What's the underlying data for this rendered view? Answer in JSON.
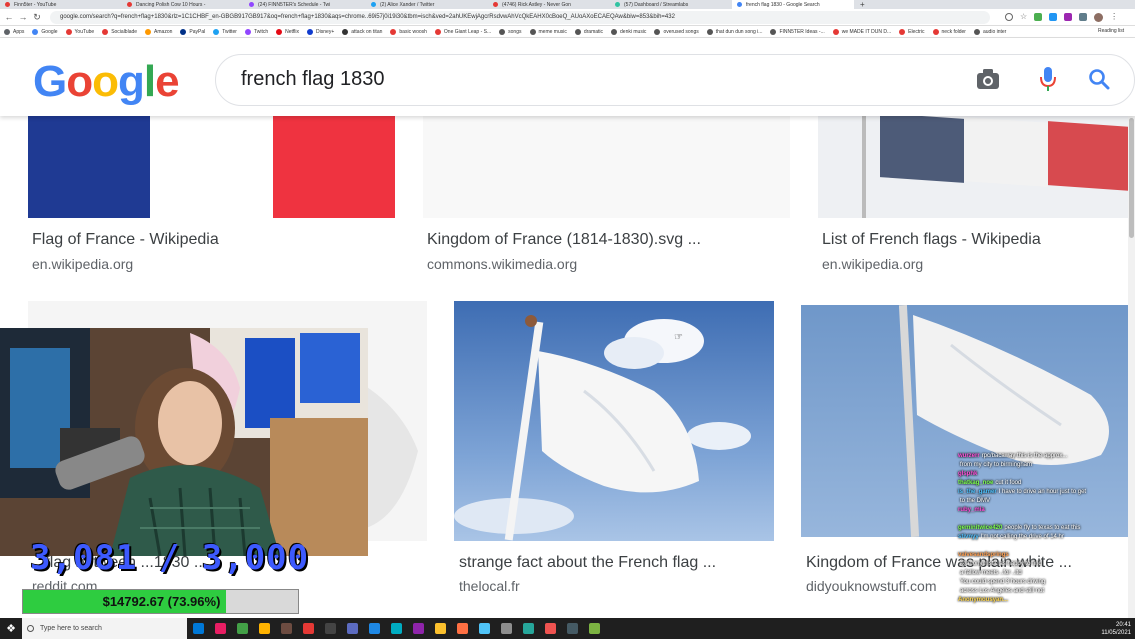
{
  "browser": {
    "tabs": [
      {
        "title": "Finn5ter - YouTube",
        "color": "#e53935"
      },
      {
        "title": "Dancing Polish Cow 10 Hours -",
        "color": "#e53935"
      },
      {
        "title": "(24) FINN5TER's Schedule - Twi",
        "color": "#9146ff"
      },
      {
        "title": "(2) Alice Xander / Twitter",
        "color": "#1da1f2"
      },
      {
        "title": "(4746) Rick Astley - Never Gon",
        "color": "#e53935"
      },
      {
        "title": "(57) Dashboard / Streamlabs",
        "color": "#31c3a2"
      },
      {
        "title": "french flag 1830 - Google Search",
        "color": "#4285f4"
      }
    ],
    "url": "google.com/search?q=french+flag+1830&rlz=1C1CHBF_en-GBGB917GB917&oq=french+flag+1830&aqs=chrome..69i57j0i19i30&tbm=isch&ved=2ahUKEwjAgcrRsdvwAhVcQkEAHX0cBoeQ_AUoAXoECAEQAw&biw=853&bih=432",
    "bookmarks": [
      {
        "label": "Apps",
        "color": "#5f6368"
      },
      {
        "label": "Google",
        "color": "#4285f4"
      },
      {
        "label": "YouTube",
        "color": "#e53935"
      },
      {
        "label": "Socialblade",
        "color": "#e53935"
      },
      {
        "label": "Amazon",
        "color": "#ff9900"
      },
      {
        "label": "PayPal",
        "color": "#003087"
      },
      {
        "label": "Twitter",
        "color": "#1da1f2"
      },
      {
        "label": "Twitch",
        "color": "#9146ff"
      },
      {
        "label": "Netflix",
        "color": "#e50914"
      },
      {
        "label": "Disney+",
        "color": "#113ccf"
      },
      {
        "label": "attack on titan",
        "color": "#333333"
      },
      {
        "label": "basic woosh",
        "color": "#e53935"
      },
      {
        "label": "One Giant Leap - S...",
        "color": "#e53935"
      },
      {
        "label": "songs",
        "color": "#555555"
      },
      {
        "label": "meme music",
        "color": "#555555"
      },
      {
        "label": "dramatic",
        "color": "#555555"
      },
      {
        "label": "denki music",
        "color": "#555555"
      },
      {
        "label": "overused songs",
        "color": "#555555"
      },
      {
        "label": "that dun dun song i...",
        "color": "#555555"
      },
      {
        "label": "FINN5TER Ideas -...",
        "color": "#555555"
      },
      {
        "label": "we MADE IT DUN D...",
        "color": "#e53935"
      },
      {
        "label": "Electric",
        "color": "#e53935"
      },
      {
        "label": "neck folder",
        "color": "#e53935"
      },
      {
        "label": "audio inter",
        "color": "#555555"
      }
    ],
    "reading_list": "Reading list"
  },
  "google": {
    "logo": {
      "letters": [
        "G",
        "o",
        "o",
        "g",
        "l",
        "e"
      ],
      "colors": [
        "#4285f4",
        "#ea4335",
        "#fbbc05",
        "#4285f4",
        "#34a853",
        "#ea4335"
      ]
    },
    "query": "french flag 1830"
  },
  "results": [
    {
      "title": "Flag of France - Wikipedia",
      "source": "en.wikipedia.org"
    },
    {
      "title": "Kingdom of France (1814-1830).svg ...",
      "source": "commons.wikimedia.org"
    },
    {
      "title": "List of French flags - Wikipedia",
      "source": "en.wikipedia.org"
    },
    {
      "title": "...flag between ...1830 ...",
      "source": "reddit.com"
    },
    {
      "title": "strange fact about the French flag ...",
      "source": "thelocal.fr"
    },
    {
      "title": "Kingdom of France was plain white ...",
      "source": "didyouknowstuff.com"
    }
  ],
  "stream": {
    "sub_counter": "3,081 / 3,000",
    "donation_text": "$14792.67 (73.96%)",
    "donation_progress": 0.7396,
    "chat": [
      {
        "user": "wurzerr",
        "text": "rpc/bacaway this is the approx...",
        "color": "#ff4fd8"
      },
      {
        "user": "",
        "text": "from my city to birmingham",
        "color": "#ffffff"
      },
      {
        "user": "glsphk",
        "text": "",
        "color": "#ff4fd8"
      },
      {
        "user": "thatkag_noe",
        "text": "cut it food",
        "color": "#7dff4f"
      },
      {
        "user": "is_the_gamer",
        "text": "I have to drive an hour just to get",
        "color": "#4fc3ff"
      },
      {
        "user": "",
        "text": "to the DMV",
        "color": "#ffffff"
      },
      {
        "user": "ruby_mia",
        "text": "",
        "color": "#ff4fd8"
      },
      {
        "user": "",
        "text": "",
        "color": "#ffffff"
      },
      {
        "user": "geminitwice420",
        "text": "people fly to texas to eat this",
        "color": "#7dff4f"
      },
      {
        "user": "stivnyy",
        "text": "I'm not calling the drive of 14 hr",
        "color": "#4fc3ff"
      },
      {
        "user": "",
        "text": "",
        "color": "#ffffff"
      },
      {
        "user": "vaivesandsprings",
        "text": "",
        "color": "#ff9f4f"
      },
      {
        "user": "",
        "text": "@anonymistic as happy to find",
        "color": "#ffffff"
      },
      {
        "user": "",
        "text": "a fallow meets ..for ..ltd",
        "color": "#ffffff"
      },
      {
        "user": "",
        "text": "You could spend 3 hours driving",
        "color": "#ffffff"
      },
      {
        "user": "",
        "text": "across Los Angeles and still not",
        "color": "#ffffff"
      },
      {
        "user": "Anonymousyan...",
        "text": "",
        "color": "#ffd84f"
      }
    ]
  },
  "taskbar": {
    "search_placeholder": "Type here to search",
    "time": "20:41",
    "date": "11/05/2021",
    "apps": [
      "#0078d7",
      "#e91e63",
      "#43a047",
      "#ffb300",
      "#6d4c41",
      "#e53935",
      "#444444",
      "#5c6bc0",
      "#1e88e5",
      "#00acc1",
      "#8e24aa",
      "#fbc02d",
      "#ff7043",
      "#4fc3f7",
      "#8e8e8e",
      "#26a69a",
      "#ef5350",
      "#455a64",
      "#7cb342"
    ]
  }
}
